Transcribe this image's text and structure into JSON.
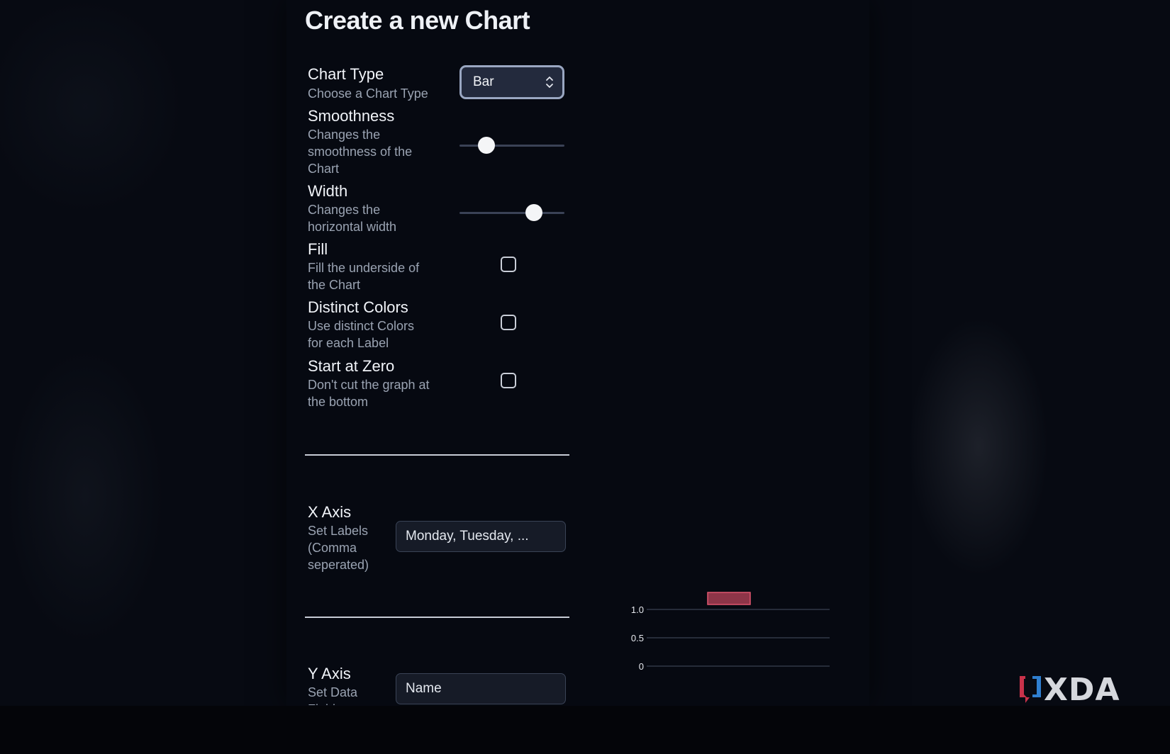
{
  "page": {
    "title": "Create a new Chart"
  },
  "settings": {
    "chart_type": {
      "label": "Chart Type",
      "description": "Choose a Chart Type",
      "value": "Bar"
    },
    "smoothness": {
      "label": "Smoothness",
      "description": "Changes the smoothness of the Chart",
      "level_fraction": 0.26
    },
    "width": {
      "label": "Width",
      "description": "Changes the horizontal width",
      "level_fraction": 0.71
    },
    "fill": {
      "label": "Fill",
      "description": "Fill the underside of the Chart",
      "checked": false
    },
    "distinct_colors": {
      "label": "Distinct Colors",
      "description": "Use distinct Colors for each Label",
      "checked": false
    },
    "start_at_zero": {
      "label": "Start at Zero",
      "description": "Don't cut the graph at the bottom",
      "checked": false
    }
  },
  "x_axis": {
    "label": "X Axis",
    "description": "Set Labels (Comma seperated)",
    "placeholder": "Monday, Tuesday, ..."
  },
  "y_axis": {
    "label": "Y Axis",
    "description": "Set Data Fields",
    "placeholder": "Name"
  },
  "chart_data": {
    "type": "bar",
    "categories": [
      ""
    ],
    "values": [
      1
    ],
    "yticks": [
      "1.0",
      "0.5",
      "0"
    ],
    "ylim": [
      0,
      1
    ],
    "bar_color": "#c8485f",
    "bar_border": "#e0566f",
    "grid": true
  },
  "watermark": {
    "text": "XDA",
    "accent_red": "#c8324a",
    "accent_blue": "#2f7fd0"
  }
}
